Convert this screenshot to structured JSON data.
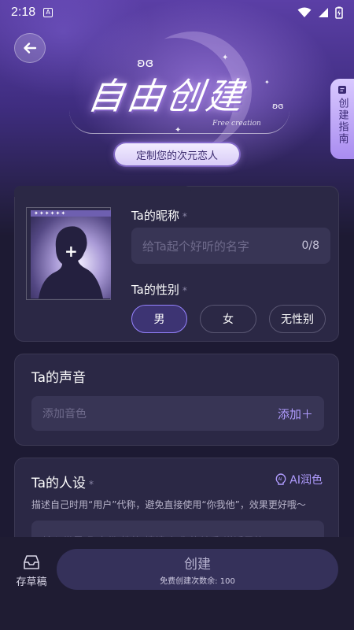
{
  "status_bar": {
    "time": "2:18",
    "app_icon": "A"
  },
  "header": {
    "title": "自由创建",
    "title_sub": "Free creation",
    "subtitle": "定制您的次元恋人",
    "guide_tab": "创建指南"
  },
  "profile": {
    "avatar_strip": "✦✦✦✦✦✦",
    "avatar_plus": "+",
    "nickname_label": "Ta的昵称",
    "required_mark": "*",
    "nickname_placeholder": "给Ta起个好听的名字",
    "nickname_count": "0/8",
    "gender_label": "Ta的性别",
    "gender_options": [
      "男",
      "女",
      "无性别"
    ],
    "gender_selected": "男"
  },
  "voice": {
    "title": "Ta的声音",
    "placeholder": "添加音色",
    "add_label": "添加＋"
  },
  "persona": {
    "title": "Ta的人设",
    "required_mark": "*",
    "ai_label": "AI润色",
    "hint": "描述自己时用“用户”代称，避免直接使用“你我他”，效果更好哦～",
    "input_text": "输入世界观/身份/性格/情境/与你的关系/说话风格"
  },
  "bottom_bar": {
    "draft_label": "存草稿",
    "create_label": "创建",
    "create_sub": "免费创建次数余: 100"
  },
  "colors": {
    "accent": "#9683ff",
    "background": "#1d1a33",
    "card": "#2b2845"
  },
  "icons": [
    "back-arrow-icon",
    "wifi-icon",
    "signal-icon",
    "battery-icon",
    "guide-doc-icon",
    "ai-bulb-icon",
    "inbox-icon"
  ]
}
